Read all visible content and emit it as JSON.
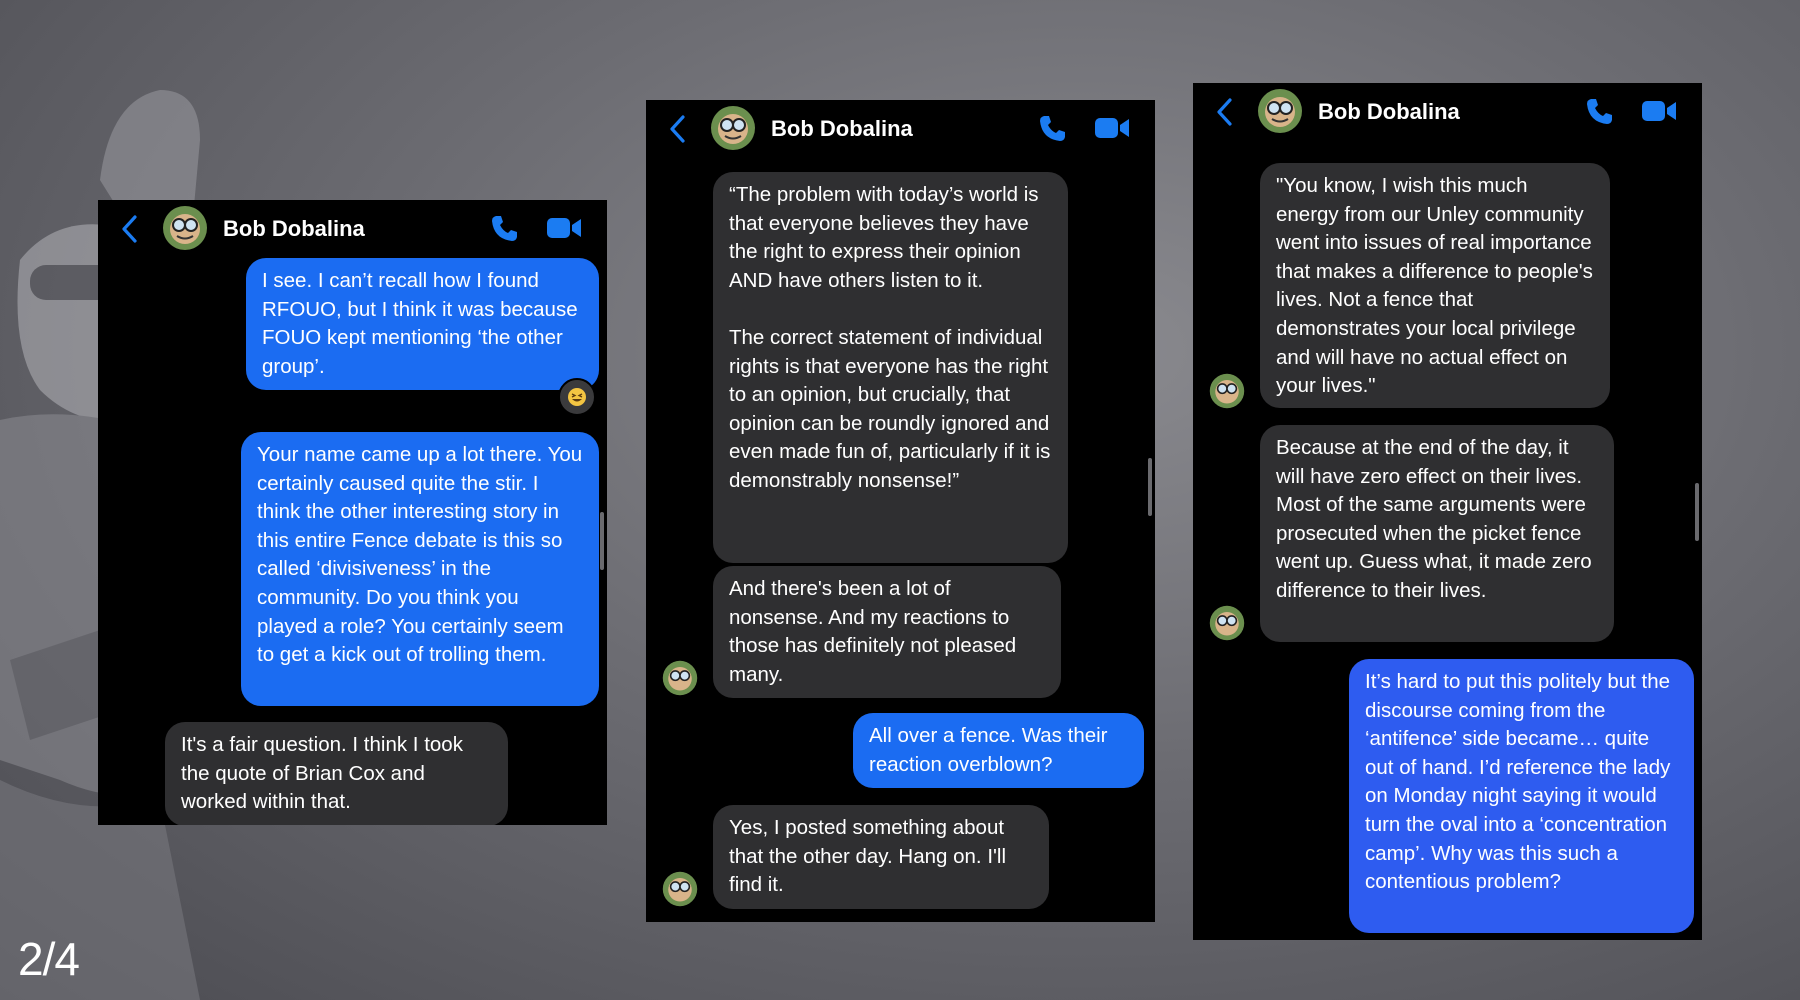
{
  "page": {
    "indicator": "2/4"
  },
  "contact": {
    "name": "Bob Dobalina"
  },
  "colors": {
    "accent": "#1b6cf2",
    "incoming_bubble": "#2f2f31",
    "panel_bg": "#000000"
  },
  "icons": {
    "back": "chevron-left-icon",
    "phone": "phone-icon",
    "video": "video-camera-icon",
    "reaction": "grinning-squint-emoji"
  },
  "panels": [
    {
      "messages": [
        {
          "from": "me",
          "text": "I see. I can’t recall how I found RFOUO, but I think it was because FOUO kept mentioning ‘the other group’."
        },
        {
          "from": "me",
          "text": "Your name came up a lot there. You certainly caused quite the stir. I think the other interesting story in this entire Fence debate is this so called ‘divisiveness’ in the community. Do you think you played a role? You certainly seem to get a kick out of trolling them."
        },
        {
          "from": "bob",
          "text": "It's a fair question. I think I took the quote of Brian Cox and worked within that."
        }
      ]
    },
    {
      "messages": [
        {
          "from": "bob",
          "text": "“The problem with today’s world is that everyone believes they have the right to express their opinion AND have others listen to it.",
          "text2": "The correct statement of individual rights is that everyone has the right to an opinion, but crucially, that opinion can be roundly ignored and even made fun of, particularly if it is demonstrably nonsense!”"
        },
        {
          "from": "bob",
          "text": "And there's been a lot of nonsense. And my reactions to those has definitely not pleased many."
        },
        {
          "from": "me",
          "text": "All over a fence. Was their reaction overblown?"
        },
        {
          "from": "bob",
          "text": "Yes, I posted something about that the other day. Hang on. I'll find it."
        }
      ]
    },
    {
      "messages": [
        {
          "from": "bob",
          "text": "\"You know, I wish this much energy from our Unley community went into issues of real importance that makes a difference to people's lives. Not a fence that demonstrates your local privilege and will have no actual effect on your lives.\""
        },
        {
          "from": "bob",
          "text": "Because at the end of the day, it will have zero effect on their lives. Most of the same arguments were prosecuted when the picket fence went up. Guess what, it made zero difference to their lives."
        },
        {
          "from": "me",
          "text": "It’s hard to put this politely but the discourse coming from the ‘antifence’ side became… quite out of hand. I’d reference the lady on Monday night saying it would turn the oval into a ‘concentration camp’. Why was this such a contentious problem?"
        }
      ]
    }
  ]
}
